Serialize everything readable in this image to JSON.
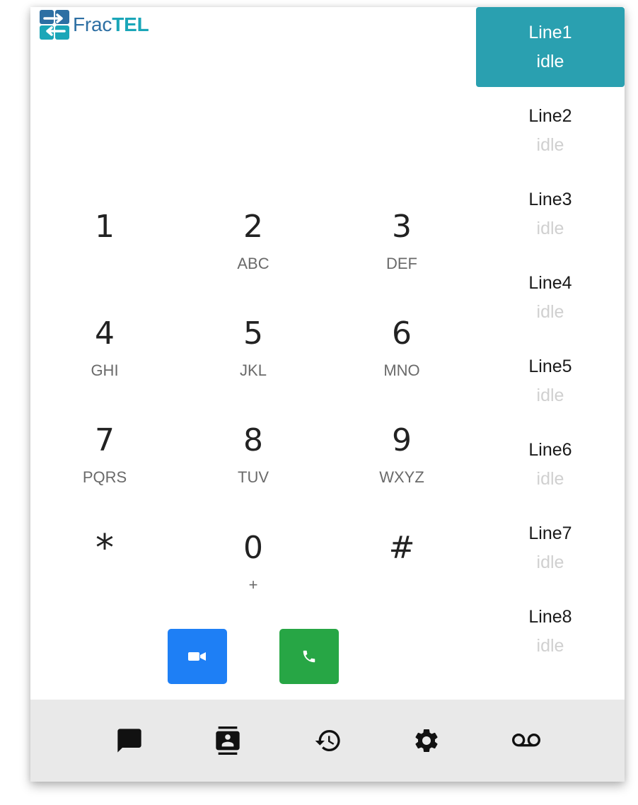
{
  "logo": {
    "text_prefix": "Frac",
    "text_suffix": "TEL"
  },
  "lines": [
    {
      "name": "Line1",
      "status": "idle",
      "active": true
    },
    {
      "name": "Line2",
      "status": "idle",
      "active": false
    },
    {
      "name": "Line3",
      "status": "idle",
      "active": false
    },
    {
      "name": "Line4",
      "status": "idle",
      "active": false
    },
    {
      "name": "Line5",
      "status": "idle",
      "active": false
    },
    {
      "name": "Line6",
      "status": "idle",
      "active": false
    },
    {
      "name": "Line7",
      "status": "idle",
      "active": false
    },
    {
      "name": "Line8",
      "status": "idle",
      "active": false
    }
  ],
  "keypad": [
    {
      "digit": "1",
      "letters": ""
    },
    {
      "digit": "2",
      "letters": "ABC"
    },
    {
      "digit": "3",
      "letters": "DEF"
    },
    {
      "digit": "4",
      "letters": "GHI"
    },
    {
      "digit": "5",
      "letters": "JKL"
    },
    {
      "digit": "6",
      "letters": "MNO"
    },
    {
      "digit": "7",
      "letters": "PQRS"
    },
    {
      "digit": "8",
      "letters": "TUV"
    },
    {
      "digit": "9",
      "letters": "WXYZ"
    },
    {
      "digit": "*",
      "letters": ""
    },
    {
      "digit": "0",
      "letters": "+"
    },
    {
      "digit": "#",
      "letters": ""
    }
  ],
  "call_buttons": {
    "video": {
      "icon": "video-camera-icon",
      "color": "#1e7ff5"
    },
    "voice": {
      "icon": "phone-icon",
      "color": "#27a645"
    }
  },
  "bottom_nav": [
    {
      "icon": "chat-icon"
    },
    {
      "icon": "contacts-icon"
    },
    {
      "icon": "history-icon"
    },
    {
      "icon": "settings-gear-icon"
    },
    {
      "icon": "voicemail-icon"
    }
  ],
  "colors": {
    "active_line": "#2aa0b0",
    "idle_text": "#d0d0d0",
    "bottom_bar": "#e9e9e9"
  }
}
